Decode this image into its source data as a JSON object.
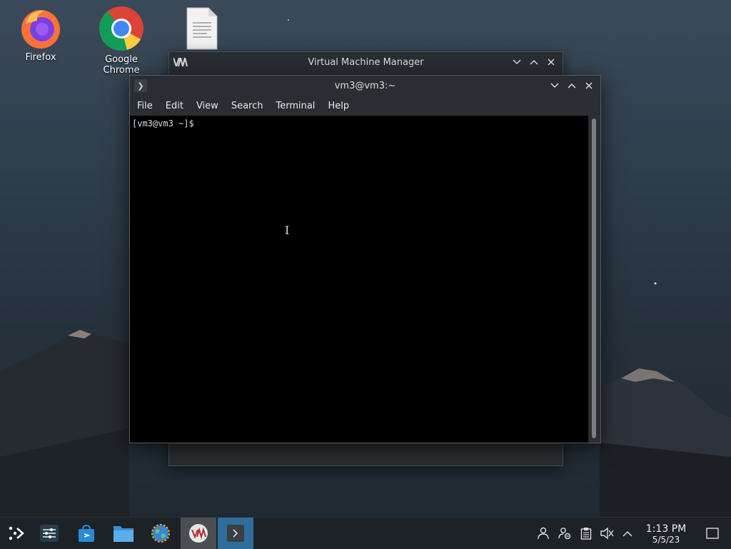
{
  "desktop": {
    "icons": [
      {
        "label": "Firefox",
        "icon": "firefox-icon"
      },
      {
        "label": "Google Chrome",
        "icon": "chrome-icon"
      },
      {
        "label": "",
        "icon": "text-document-icon"
      }
    ]
  },
  "vmm_window": {
    "title": "Virtual Machine Manager",
    "app_icon": "vmm-logo-icon",
    "controls": [
      "minimize",
      "maximize",
      "close"
    ]
  },
  "terminal_window": {
    "title": "vm3@vm3:~",
    "menu": [
      "File",
      "Edit",
      "View",
      "Search",
      "Terminal",
      "Help"
    ],
    "prompt": "[vm3@vm3 ~]$",
    "controls": [
      "minimize",
      "maximize",
      "close"
    ]
  },
  "taskbar": {
    "items": [
      {
        "name": "application-launcher",
        "icon": "launcher-icon"
      },
      {
        "name": "system-settings",
        "icon": "sliders-icon"
      },
      {
        "name": "discover",
        "icon": "store-bag-icon"
      },
      {
        "name": "file-manager",
        "icon": "folder-icon"
      },
      {
        "name": "browser",
        "icon": "globe-icon"
      },
      {
        "name": "virtual-machine-manager",
        "icon": "vmm-logo-icon"
      },
      {
        "name": "terminal",
        "icon": "terminal-icon"
      }
    ],
    "tray": [
      "user-icon",
      "user-network-icon",
      "clipboard-icon",
      "volume-muted-icon",
      "chevron-up-icon"
    ],
    "clock": {
      "time": "1:13 PM",
      "date": "5/5/23"
    }
  },
  "colors": {
    "accent": "#2f6e9a",
    "terminal_bg": "#000000",
    "window_bg": "#2a2e32"
  }
}
